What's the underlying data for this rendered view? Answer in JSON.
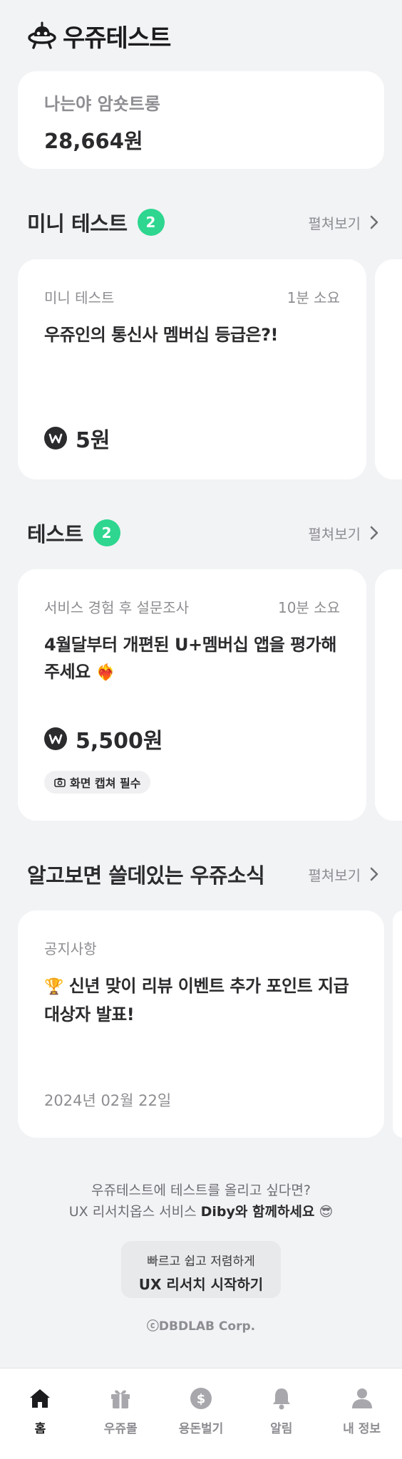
{
  "app": {
    "title": "우쥬테스트"
  },
  "balance": {
    "name": "나는야 암숏트롱",
    "amount": "28,664원"
  },
  "mini_section": {
    "title": "미니 테스트",
    "count": "2",
    "more": "펼쳐보기",
    "card": {
      "category": "미니 테스트",
      "duration": "1분 소요",
      "title": "우쥬인의 통신사 멤버십 등급은?!",
      "reward": "5원"
    }
  },
  "test_section": {
    "title": "테스트",
    "count": "2",
    "more": "펼쳐보기",
    "card": {
      "category": "서비스 경험 후 설문조사",
      "duration": "10분 소요",
      "title": "4월달부터 개편된 U+멤버십 앱을 평가해 주세요",
      "title_emoji": "❤️‍🔥",
      "reward": "5,500원",
      "chip": "화면 캡쳐 필수"
    }
  },
  "news_section": {
    "title": "알고보면 쓸데있는 우쥬소식",
    "more": "펼쳐보기",
    "card": {
      "category": "공지사항",
      "title_emoji": "🏆",
      "title": "신년 맞이 리뷰 이벤트 추가 포인트 지급 대상자 발표!",
      "date": "2024년 02월 22일"
    }
  },
  "promo": {
    "line1": "우쥬테스트에 테스트를 올리고 싶다면?",
    "line2_prefix": "UX 리서치옵스 서비스 ",
    "line2_bold": "Diby와 함께하세요",
    "line2_emoji": "😎",
    "cta_small": "빠르고 쉽고 저렴하게",
    "cta_big": "UX 리서치 시작하기",
    "copyright": "ⓒDBDLAB Corp."
  },
  "tabs": [
    {
      "label": "홈",
      "icon": "home-icon",
      "active": true
    },
    {
      "label": "우쥬몰",
      "icon": "gift-icon",
      "active": false
    },
    {
      "label": "용돈벌기",
      "icon": "dollar-coin-icon",
      "active": false
    },
    {
      "label": "알림",
      "icon": "bell-icon",
      "active": false
    },
    {
      "label": "내 정보",
      "icon": "person-icon",
      "active": false
    }
  ],
  "colors": {
    "accent_green": "#2ed68f",
    "background": "#f2f3f5",
    "card": "#ffffff",
    "text_dark": "#2b2b2e",
    "text_muted": "#8d8d92"
  }
}
